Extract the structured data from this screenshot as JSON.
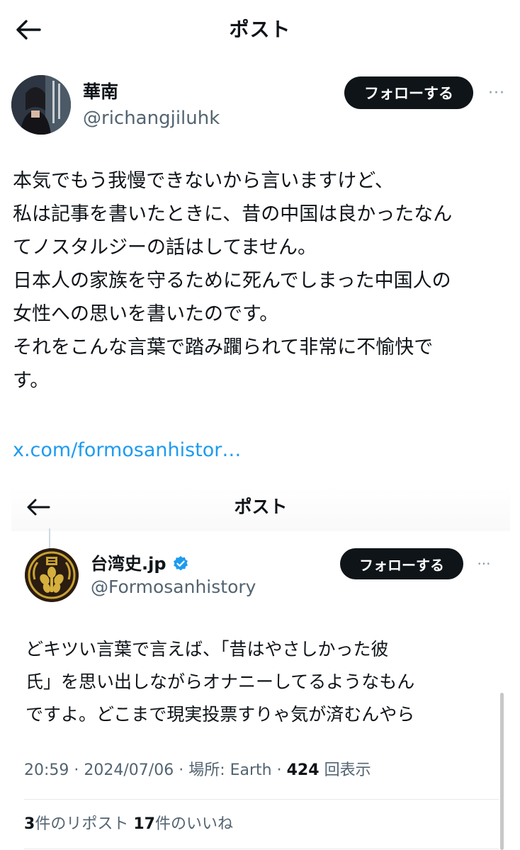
{
  "header": {
    "title": "ポスト"
  },
  "author": {
    "name": "華南",
    "handle": "@richangjiluhk",
    "follow_label": "フォローする",
    "more_label": "···"
  },
  "post": {
    "text": "本気でもう我慢できないから言いますけど、\n私は記事を書いたときに、昔の中国は良かったなん\nてノスタルジーの話はしてません。\n日本人の家族を守るために死んでしまった中国人の\n女性への思いを書いたのです。\nそれをこんな言葉で踏み躙られて非常に不愉快で\nす。",
    "link": "x.com/formosanhistor…"
  },
  "embedded": {
    "title": "ポスト",
    "author": {
      "name": "台湾史.jp",
      "handle": "@Formosanhistory",
      "follow_label": "フォローする",
      "more_label": "···"
    },
    "text": "どキツい言葉で言えば、「昔はやさしかった彼\n氏」を思い出しながらオナニーしてるようなもん\nですよ。どこまで現実投票すりゃ気が済むんやら",
    "meta": {
      "time": "20:59",
      "date": "2024/07/06",
      "location_label": "場所: Earth",
      "views_count": "424",
      "views_label": "回表示"
    },
    "stats": {
      "reposts_count": "3",
      "reposts_label": "件のリポスト",
      "likes_count": "17",
      "likes_label": "件のいいね"
    }
  },
  "colors": {
    "text": "#0f1419",
    "secondary": "#536471",
    "link": "#1d9bf0",
    "button": "#0f1419",
    "verified": "#1d9bf0"
  }
}
